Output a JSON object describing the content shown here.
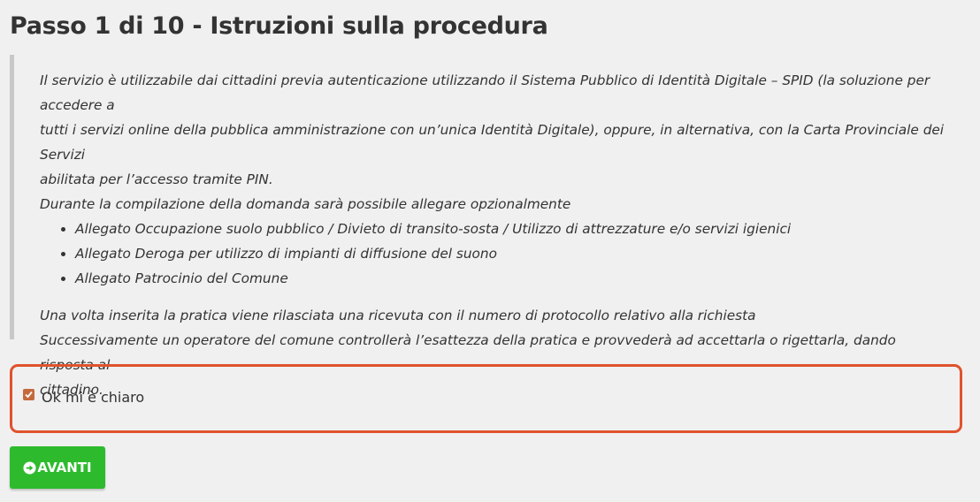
{
  "header": {
    "title": "Passo 1 di 10 - Istruzioni sulla procedura"
  },
  "instructions": {
    "paragraph1_line1": "Il servizio è utilizzabile dai cittadini previa autenticazione utilizzando il Sistema Pubblico di Identità Digitale – SPID (la soluzione per accedere a",
    "paragraph1_line2": "tutti i servizi online della pubblica amministrazione con un’unica Identità Digitale), oppure, in alternativa, con la Carta Provinciale dei Servizi",
    "paragraph1_line3": "abilitata per l’accesso tramite PIN.",
    "paragraph2": "Durante la compilazione della domanda sarà possibile allegare opzionalmente",
    "attachments": [
      "Allegato Occupazione suolo pubblico / Divieto di transito-sosta / Utilizzo di attrezzature e/o servizi igienici",
      "Allegato Deroga per utilizzo di impianti di diffusione del suono",
      "Allegato Patrocinio del Comune"
    ],
    "paragraph3": "Una volta inserita la pratica viene rilasciata una ricevuta con il numero di protocollo relativo alla richiesta",
    "paragraph4_line1": "Successivamente un operatore del comune controllerà l’esattezza della pratica e provvederà ad accettarla o rigettarla, dando risposta al",
    "paragraph4_line2": "cittadino."
  },
  "confirm": {
    "label": "Ok mi è chiaro",
    "checked": true
  },
  "actions": {
    "next_label": "AVANTI",
    "next_icon": "arrow-circle-right-icon"
  },
  "colors": {
    "highlight_border": "#e0522d",
    "checkbox": "#c56a3b",
    "next_button": "#2dbb2d"
  }
}
